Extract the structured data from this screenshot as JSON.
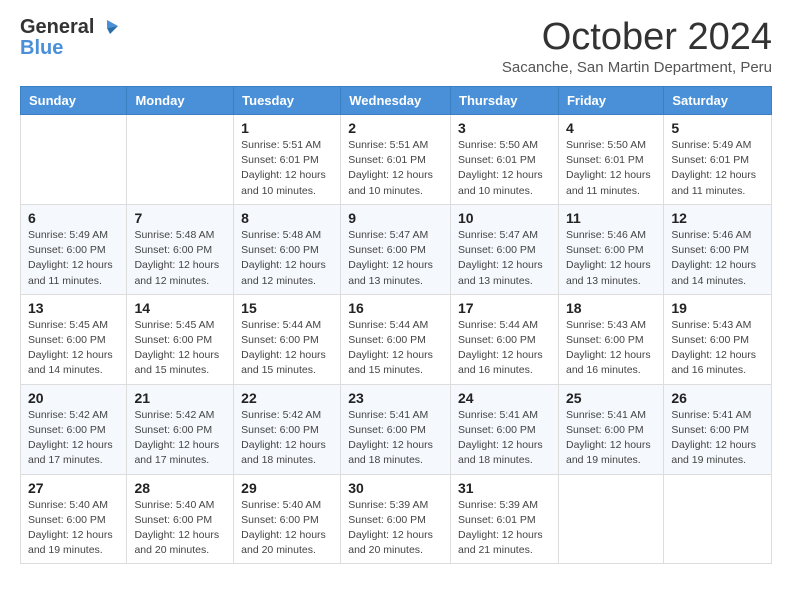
{
  "header": {
    "logo_general": "General",
    "logo_blue": "Blue",
    "month_title": "October 2024",
    "subtitle": "Sacanche, San Martin Department, Peru"
  },
  "days_of_week": [
    "Sunday",
    "Monday",
    "Tuesday",
    "Wednesday",
    "Thursday",
    "Friday",
    "Saturday"
  ],
  "weeks": [
    {
      "days": [
        {
          "number": "",
          "info": ""
        },
        {
          "number": "",
          "info": ""
        },
        {
          "number": "1",
          "info": "Sunrise: 5:51 AM\nSunset: 6:01 PM\nDaylight: 12 hours and 10 minutes."
        },
        {
          "number": "2",
          "info": "Sunrise: 5:51 AM\nSunset: 6:01 PM\nDaylight: 12 hours and 10 minutes."
        },
        {
          "number": "3",
          "info": "Sunrise: 5:50 AM\nSunset: 6:01 PM\nDaylight: 12 hours and 10 minutes."
        },
        {
          "number": "4",
          "info": "Sunrise: 5:50 AM\nSunset: 6:01 PM\nDaylight: 12 hours and 11 minutes."
        },
        {
          "number": "5",
          "info": "Sunrise: 5:49 AM\nSunset: 6:01 PM\nDaylight: 12 hours and 11 minutes."
        }
      ]
    },
    {
      "days": [
        {
          "number": "6",
          "info": "Sunrise: 5:49 AM\nSunset: 6:00 PM\nDaylight: 12 hours and 11 minutes."
        },
        {
          "number": "7",
          "info": "Sunrise: 5:48 AM\nSunset: 6:00 PM\nDaylight: 12 hours and 12 minutes."
        },
        {
          "number": "8",
          "info": "Sunrise: 5:48 AM\nSunset: 6:00 PM\nDaylight: 12 hours and 12 minutes."
        },
        {
          "number": "9",
          "info": "Sunrise: 5:47 AM\nSunset: 6:00 PM\nDaylight: 12 hours and 13 minutes."
        },
        {
          "number": "10",
          "info": "Sunrise: 5:47 AM\nSunset: 6:00 PM\nDaylight: 12 hours and 13 minutes."
        },
        {
          "number": "11",
          "info": "Sunrise: 5:46 AM\nSunset: 6:00 PM\nDaylight: 12 hours and 13 minutes."
        },
        {
          "number": "12",
          "info": "Sunrise: 5:46 AM\nSunset: 6:00 PM\nDaylight: 12 hours and 14 minutes."
        }
      ]
    },
    {
      "days": [
        {
          "number": "13",
          "info": "Sunrise: 5:45 AM\nSunset: 6:00 PM\nDaylight: 12 hours and 14 minutes."
        },
        {
          "number": "14",
          "info": "Sunrise: 5:45 AM\nSunset: 6:00 PM\nDaylight: 12 hours and 15 minutes."
        },
        {
          "number": "15",
          "info": "Sunrise: 5:44 AM\nSunset: 6:00 PM\nDaylight: 12 hours and 15 minutes."
        },
        {
          "number": "16",
          "info": "Sunrise: 5:44 AM\nSunset: 6:00 PM\nDaylight: 12 hours and 15 minutes."
        },
        {
          "number": "17",
          "info": "Sunrise: 5:44 AM\nSunset: 6:00 PM\nDaylight: 12 hours and 16 minutes."
        },
        {
          "number": "18",
          "info": "Sunrise: 5:43 AM\nSunset: 6:00 PM\nDaylight: 12 hours and 16 minutes."
        },
        {
          "number": "19",
          "info": "Sunrise: 5:43 AM\nSunset: 6:00 PM\nDaylight: 12 hours and 16 minutes."
        }
      ]
    },
    {
      "days": [
        {
          "number": "20",
          "info": "Sunrise: 5:42 AM\nSunset: 6:00 PM\nDaylight: 12 hours and 17 minutes."
        },
        {
          "number": "21",
          "info": "Sunrise: 5:42 AM\nSunset: 6:00 PM\nDaylight: 12 hours and 17 minutes."
        },
        {
          "number": "22",
          "info": "Sunrise: 5:42 AM\nSunset: 6:00 PM\nDaylight: 12 hours and 18 minutes."
        },
        {
          "number": "23",
          "info": "Sunrise: 5:41 AM\nSunset: 6:00 PM\nDaylight: 12 hours and 18 minutes."
        },
        {
          "number": "24",
          "info": "Sunrise: 5:41 AM\nSunset: 6:00 PM\nDaylight: 12 hours and 18 minutes."
        },
        {
          "number": "25",
          "info": "Sunrise: 5:41 AM\nSunset: 6:00 PM\nDaylight: 12 hours and 19 minutes."
        },
        {
          "number": "26",
          "info": "Sunrise: 5:41 AM\nSunset: 6:00 PM\nDaylight: 12 hours and 19 minutes."
        }
      ]
    },
    {
      "days": [
        {
          "number": "27",
          "info": "Sunrise: 5:40 AM\nSunset: 6:00 PM\nDaylight: 12 hours and 19 minutes."
        },
        {
          "number": "28",
          "info": "Sunrise: 5:40 AM\nSunset: 6:00 PM\nDaylight: 12 hours and 20 minutes."
        },
        {
          "number": "29",
          "info": "Sunrise: 5:40 AM\nSunset: 6:00 PM\nDaylight: 12 hours and 20 minutes."
        },
        {
          "number": "30",
          "info": "Sunrise: 5:39 AM\nSunset: 6:00 PM\nDaylight: 12 hours and 20 minutes."
        },
        {
          "number": "31",
          "info": "Sunrise: 5:39 AM\nSunset: 6:01 PM\nDaylight: 12 hours and 21 minutes."
        },
        {
          "number": "",
          "info": ""
        },
        {
          "number": "",
          "info": ""
        }
      ]
    }
  ]
}
